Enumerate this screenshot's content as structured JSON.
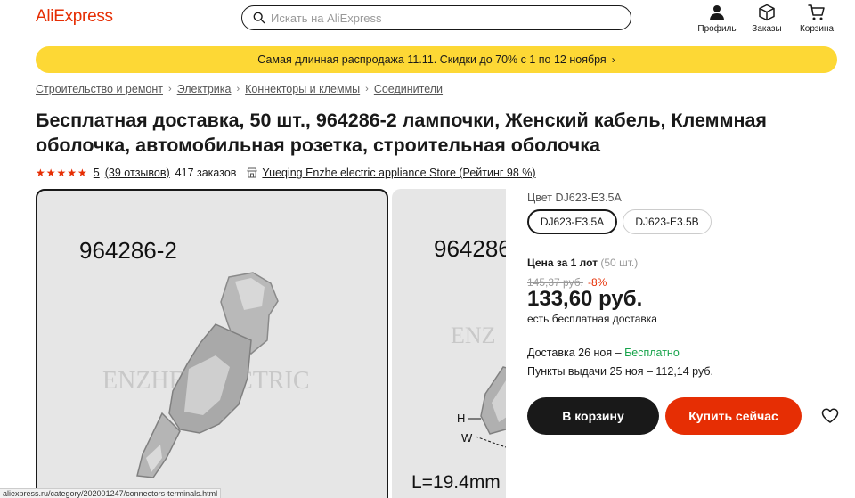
{
  "header": {
    "logo": "AliExpress",
    "search_placeholder": "Искать на AliExpress",
    "profile_label": "Профиль",
    "orders_label": "Заказы",
    "cart_label": "Корзина"
  },
  "banner": {
    "text": "Самая длинная распродажа 11.11. Скидки до 70% с 1 по 12 ноября",
    "chevron": "›"
  },
  "breadcrumb": {
    "items": [
      "Строительство и ремонт",
      "Электрика",
      "Коннекторы и клеммы",
      "Соединители"
    ],
    "separator": "›"
  },
  "product": {
    "title": "Бесплатная доставка, 50 шт., 964286-2 лампочки, Женский кабель, Клеммная оболочка, автомобильная розетка, строительная оболочка",
    "stars": "★★★★★",
    "rating": "5",
    "reviews": "(39 отзывов)",
    "orders": "417 заказов",
    "store": "Yueqing Enzhe electric appliance Store (Рейтинг 98 %)"
  },
  "gallery": {
    "image1_label": "964286-2",
    "image1_watermark": "ENZHE ELECTRIC",
    "image2_label": "964286",
    "image2_watermark": "ENZ",
    "image2_h": "H",
    "image2_w": "W",
    "image2_length": "L=19.4mm"
  },
  "options": {
    "color_label": "Цвет DJ623-E3.5A",
    "variants": [
      "DJ623-E3.5A",
      "DJ623-E3.5B"
    ],
    "selected": "DJ623-E3.5A"
  },
  "pricing": {
    "price_label": "Цена за 1 лот",
    "lot_size": "(50 шт.)",
    "old_price": "145,37 руб.",
    "discount": "-8%",
    "price": "133,60 руб.",
    "free_shipping": "есть бесплатная доставка",
    "delivery_prefix": "Доставка 26 ноя – ",
    "delivery_free": "Бесплатно",
    "pickup": "Пункты выдачи 25 ноя – 112,14 руб."
  },
  "actions": {
    "add_to_cart": "В корзину",
    "buy_now": "Купить сейчас"
  },
  "status_bar": {
    "url": "aliexpress.ru/category/202001247/connectors-terminals.html"
  },
  "colors": {
    "brand": "#e62e04",
    "banner": "#fdd835",
    "dark": "#191919",
    "green": "#16a34a"
  }
}
